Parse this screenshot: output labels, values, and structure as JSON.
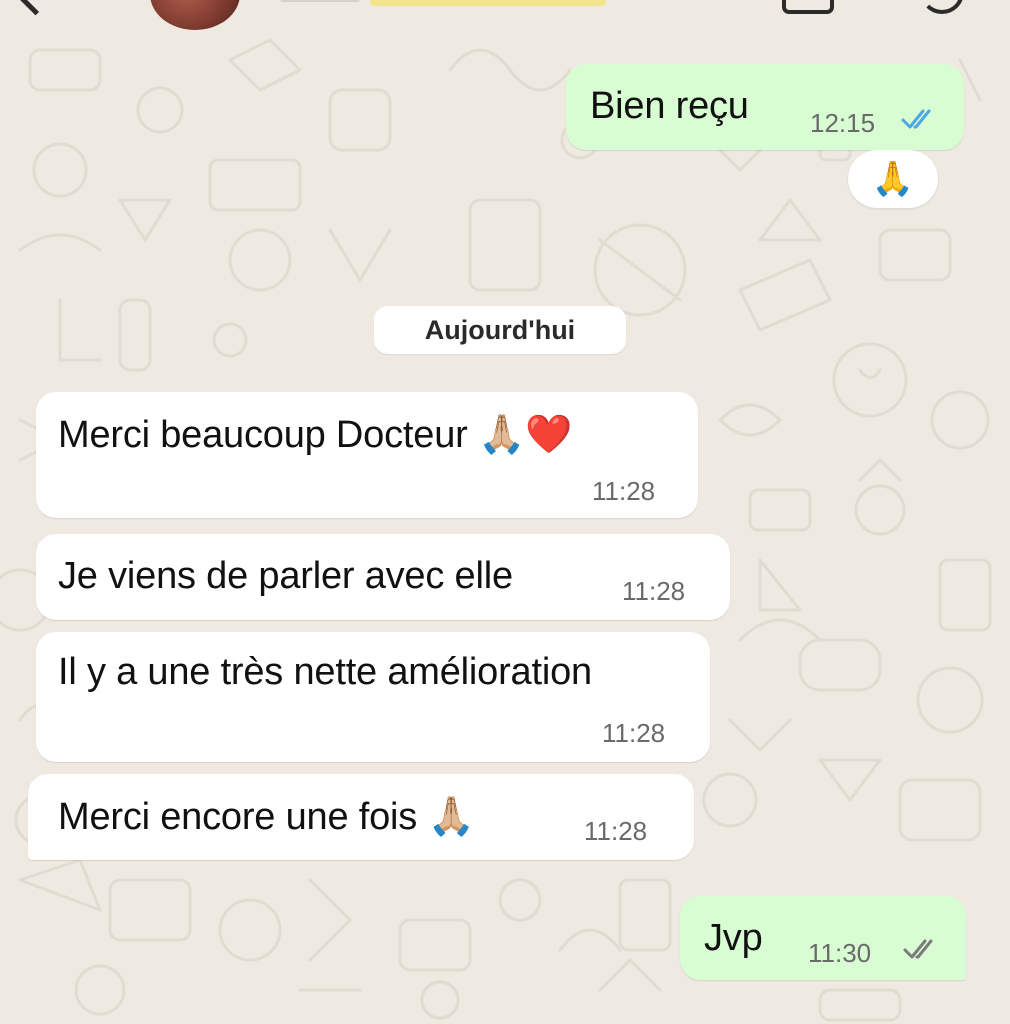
{
  "chat": {
    "date_divider": "Aujourd'hui",
    "messages": [
      {
        "direction": "out",
        "text": "Bien reçu",
        "time": "12:15",
        "status": "read"
      },
      {
        "direction": "in",
        "text": "Merci beaucoup Docteur",
        "emoji": "🙏🏼❤️",
        "time": "11:28"
      },
      {
        "direction": "in",
        "text": "Je viens de parler avec elle",
        "time": "11:28"
      },
      {
        "direction": "in",
        "text": "Il y a une très nette amélioration",
        "time": "11:28"
      },
      {
        "direction": "in",
        "text": "Merci encore une fois",
        "emoji": "🙏🏼",
        "time": "11:28"
      },
      {
        "direction": "out",
        "text": "Jvp",
        "time": "11:30",
        "status": "delivered"
      }
    ],
    "reaction": "🙏"
  },
  "colors": {
    "wallpaper": "#eee9e1",
    "incoming_bubble": "#ffffff",
    "outgoing_bubble": "#d9fdd3",
    "read_ticks": "#4fa6e6",
    "delivered_ticks": "#7b7b7b"
  },
  "icons": [
    "back-chevron-icon",
    "avatar",
    "video-call-icon",
    "phone-call-icon",
    "read-receipt-icon",
    "delivered-receipt-icon"
  ]
}
